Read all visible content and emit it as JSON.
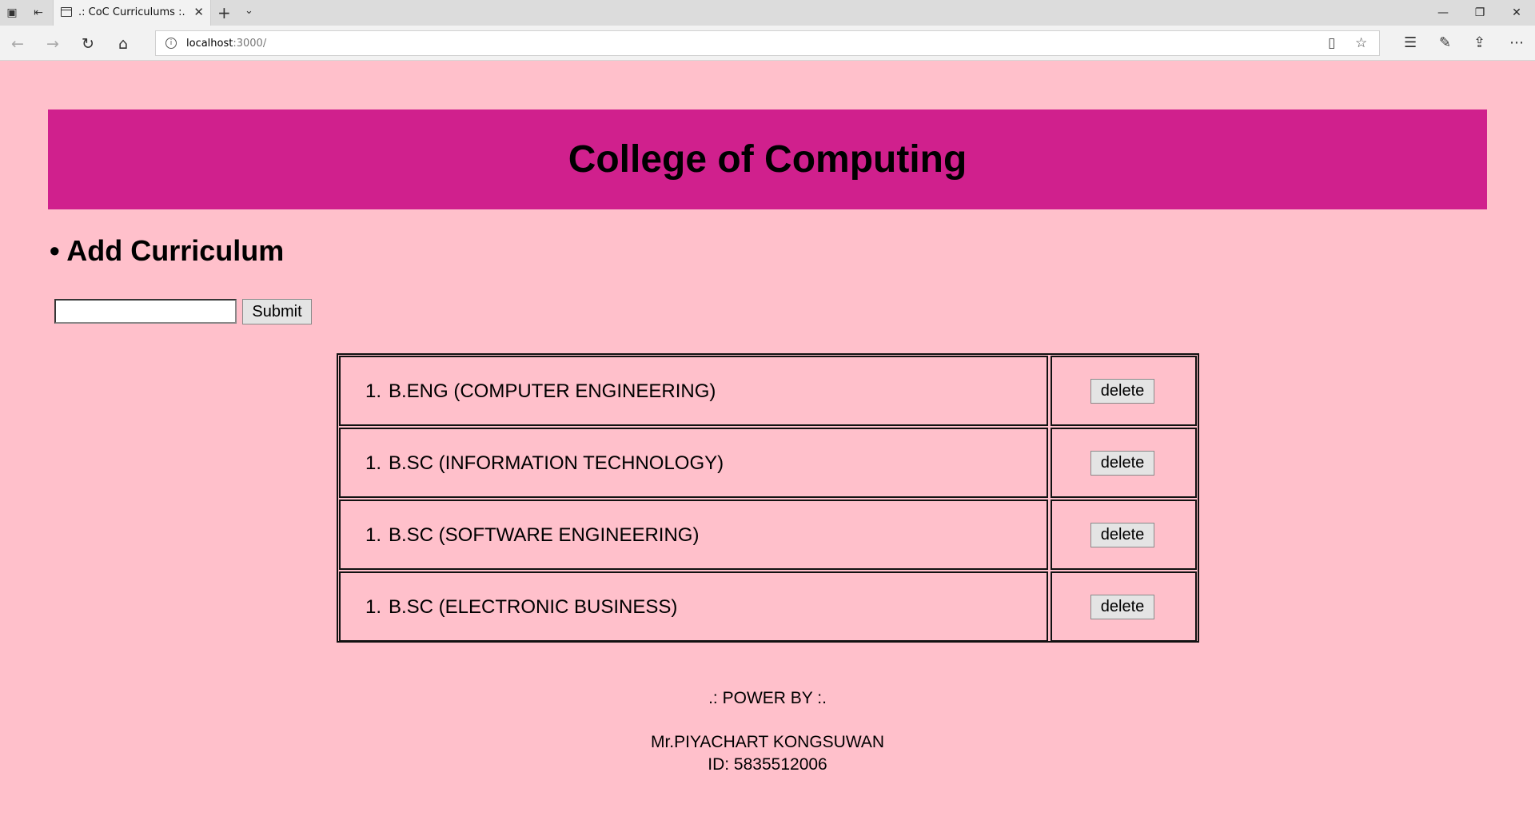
{
  "browser": {
    "tab_title": ".: CoC Curriculums :.",
    "url_host": "localhost",
    "url_rest": ":3000/"
  },
  "page": {
    "header_title": "College of Computing",
    "section_title": "• Add Curriculum",
    "input_value": "",
    "submit_label": "Submit",
    "delete_label": "delete",
    "curriculums": [
      {
        "number": "1.",
        "name": "B.ENG (COMPUTER ENGINEERING)"
      },
      {
        "number": "1.",
        "name": "B.SC (INFORMATION TECHNOLOGY)"
      },
      {
        "number": "1.",
        "name": "B.SC (SOFTWARE ENGINEERING)"
      },
      {
        "number": "1.",
        "name": "B.SC (ELECTRONIC BUSINESS)"
      }
    ],
    "footer": {
      "power_by": ".: POWER BY :.",
      "author": "Mr.PIYACHART KONGSUWAN",
      "student_id": "ID: 5835512006"
    }
  },
  "colors": {
    "page_bg": "#ffc0cb",
    "header_bg": "#d0208d"
  }
}
